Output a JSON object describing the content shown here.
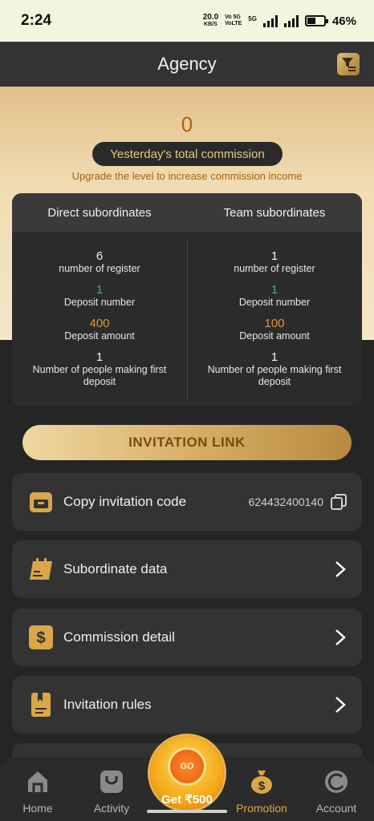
{
  "status_bar": {
    "time": "2:24",
    "net_speed": "20.0",
    "net_unit": "KB/S",
    "volte": "Vo 5G\nVoLTE",
    "network": "5G",
    "battery": "46%"
  },
  "header": {
    "title": "Agency",
    "filter_icon": "filter-icon"
  },
  "hero": {
    "amount": "0",
    "pill_label": "Yesterday's total commission",
    "hint": "Upgrade the level to increase commission income"
  },
  "stats": {
    "direct": {
      "title": "Direct subordinates",
      "register_value": "6",
      "register_label": "number of register",
      "deposit_num_value": "1",
      "deposit_num_label": "Deposit number",
      "deposit_amt_value": "400",
      "deposit_amt_label": "Deposit amount",
      "first_dep_value": "1",
      "first_dep_label": "Number of people making first deposit"
    },
    "team": {
      "title": "Team subordinates",
      "register_value": "1",
      "register_label": "number of register",
      "deposit_num_value": "1",
      "deposit_num_label": "Deposit number",
      "deposit_amt_value": "100",
      "deposit_amt_label": "Deposit amount",
      "first_dep_value": "1",
      "first_dep_label": "Number of people making first deposit"
    }
  },
  "invite_button": "INVITATION LINK",
  "menu": {
    "copy_code": {
      "label": "Copy invitation code",
      "value": "624432400140"
    },
    "subordinate": {
      "label": "Subordinate data"
    },
    "commission": {
      "label": "Commission detail"
    },
    "rules": {
      "label": "Invitation rules"
    }
  },
  "nav": {
    "home": "Home",
    "activity": "Activity",
    "center": "Get ₹500",
    "center_badge": "GO",
    "promotion": "Promotion",
    "account": "Account"
  },
  "colors": {
    "accent": "#d9a64a",
    "background": "#252525",
    "card": "#333333",
    "green": "#3cb27a",
    "orange": "#e0933c"
  }
}
